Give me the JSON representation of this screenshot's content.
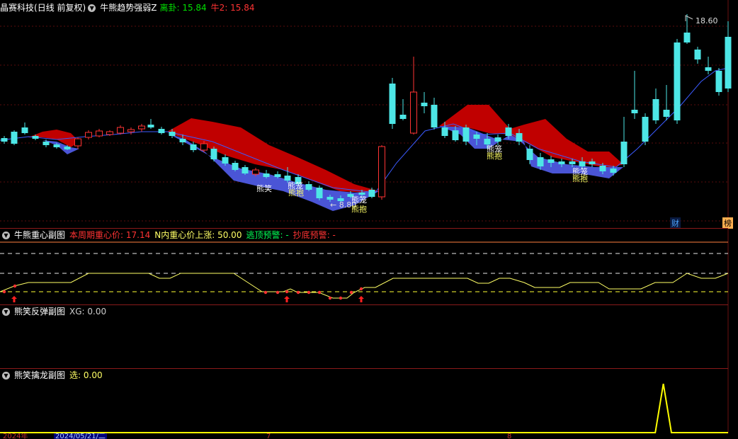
{
  "main": {
    "stock_name": "晶赛科技",
    "period_label": "(日线 前复权)",
    "indicator_name": "牛熊趋势强弱Z",
    "lines": [
      {
        "label": "离卦",
        "value": "15.84",
        "color": "#00e000"
      },
      {
        "label": "牛2",
        "value": "15.84",
        "color": "#ff3333"
      }
    ],
    "high_label": "18.60",
    "low_label": "8.80",
    "annotations": [
      "熊笑",
      "熊笼",
      "熊抱",
      "熊笼",
      "熊抱",
      "熊笼",
      "熊抱"
    ],
    "badges": [
      "财",
      "榜"
    ]
  },
  "pane1": {
    "title": "牛熊重心副图",
    "items": [
      {
        "label": "本周期重心价",
        "value": "17.14",
        "color": "#ff3333"
      },
      {
        "label": "N内重心价上涨",
        "value": "50.00",
        "color": "#ffff66"
      },
      {
        "label": "逃顶预警",
        "value": "-",
        "color": "#00ff55"
      },
      {
        "label": "抄底预警",
        "value": "-",
        "color": "#ff3333"
      }
    ]
  },
  "pane2": {
    "title": "熊笑反弹副图",
    "items": [
      {
        "label": "XG",
        "value": "0.00",
        "color": "#cccccc"
      }
    ]
  },
  "pane3": {
    "title": "熊笑擒龙副图",
    "items": [
      {
        "label": "选",
        "value": "0.00",
        "color": "#ffff66"
      }
    ],
    "signal_values": [
      0,
      0,
      0,
      0,
      0,
      0,
      0,
      0,
      0,
      0,
      0,
      0,
      0,
      0,
      0,
      0,
      0,
      0,
      0,
      0,
      0,
      0,
      0,
      0,
      0,
      0,
      0,
      0,
      0,
      0,
      0,
      0,
      0,
      0,
      0,
      0,
      0,
      0,
      0,
      0,
      0,
      0,
      0,
      0,
      0,
      0,
      0,
      0,
      0,
      0,
      0,
      0,
      0,
      0,
      0,
      0,
      0,
      0,
      0,
      0,
      0,
      0,
      0,
      0,
      0,
      0,
      0,
      0,
      0,
      0,
      0,
      0,
      0,
      0,
      0,
      0,
      0,
      0,
      0,
      0,
      0,
      0,
      1,
      0,
      0,
      0,
      0,
      0,
      0,
      0,
      0
    ]
  },
  "footer": {
    "dates": [
      "2024年",
      "2024/05/21/二",
      "7",
      "8"
    ]
  }
}
